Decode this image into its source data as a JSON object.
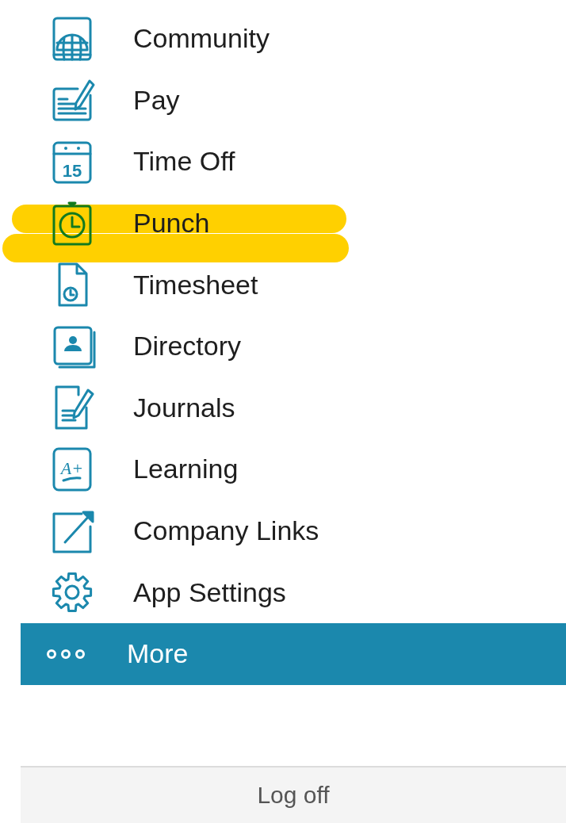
{
  "menu": {
    "items": [
      {
        "kind": "globe",
        "label": "Community",
        "highlighted": false
      },
      {
        "kind": "check",
        "label": "Pay",
        "highlighted": false
      },
      {
        "kind": "calendar",
        "label": "Time Off",
        "icon_text": "15",
        "highlighted": false
      },
      {
        "kind": "clock",
        "label": "Punch",
        "highlighted": true
      },
      {
        "kind": "timesheet",
        "label": "Timesheet",
        "highlighted": false
      },
      {
        "kind": "contact",
        "label": "Directory",
        "highlighted": false
      },
      {
        "kind": "journal",
        "label": "Journals",
        "highlighted": false
      },
      {
        "kind": "grade",
        "label": "Learning",
        "icon_text": "A+",
        "highlighted": false
      },
      {
        "kind": "link",
        "label": "Company Links",
        "highlighted": false
      },
      {
        "kind": "gear",
        "label": "App Settings",
        "highlighted": false
      },
      {
        "kind": "dots",
        "label": "More",
        "selected": true
      }
    ]
  },
  "footer": {
    "button": "Log off"
  }
}
